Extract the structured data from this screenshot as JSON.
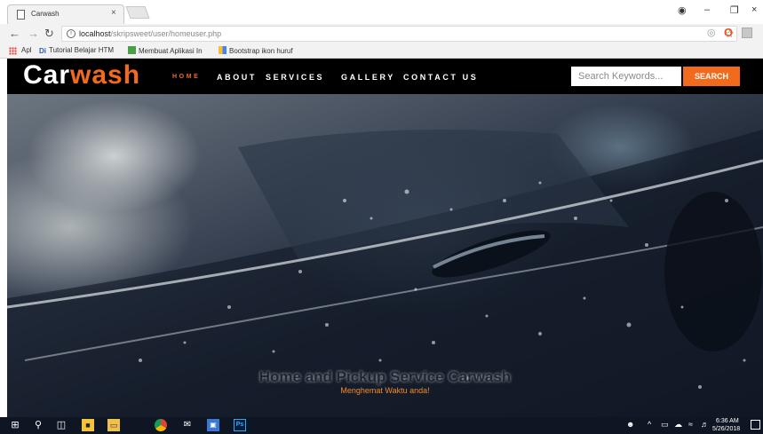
{
  "browser": {
    "tab": {
      "title": "Carwash",
      "close_icon": "close-icon"
    },
    "window_controls": {
      "minimize": "–",
      "maximize": "❐",
      "close": "×"
    },
    "address": {
      "host": "localhost",
      "path": "/skripsweet/user/homeuser.php"
    },
    "bookmarks": [
      {
        "label": "Apl",
        "icon": "apps-grid-icon"
      },
      {
        "label": "Tutorial Belajar HTM",
        "icon": "di-icon"
      },
      {
        "label": "Membuat Aplikasi In",
        "icon": "green-square-icon"
      },
      {
        "label": "Bootstrap ikon huruf",
        "icon": "dots-icon"
      }
    ]
  },
  "site": {
    "logo": {
      "part1": "Car",
      "part2": "wash"
    },
    "nav": [
      {
        "label": "HOME",
        "active": true
      },
      {
        "label": "ABOUT"
      },
      {
        "label": "SERVICES"
      },
      {
        "label": "GALLERY"
      },
      {
        "label": "CONTACT US"
      }
    ],
    "search": {
      "placeholder": "Search Keywords...",
      "button": "SEARCH"
    },
    "hero": {
      "title": "Home and Pickup Service Carwash",
      "subtitle": "Menghemat Waktu anda!"
    },
    "colors": {
      "accent": "#f26b1d",
      "header_bg": "#000000"
    }
  },
  "taskbar": {
    "apps": [
      "windows-start-icon",
      "search-icon",
      "task-view-icon",
      "store-icon",
      "file-explorer-icon",
      "chrome-icon",
      "mail-icon",
      "photos-icon",
      "photoshop-icon"
    ],
    "photoshop_label": "Ps",
    "clock": {
      "time": "6:36 AM",
      "date": "5/26/2018"
    }
  }
}
